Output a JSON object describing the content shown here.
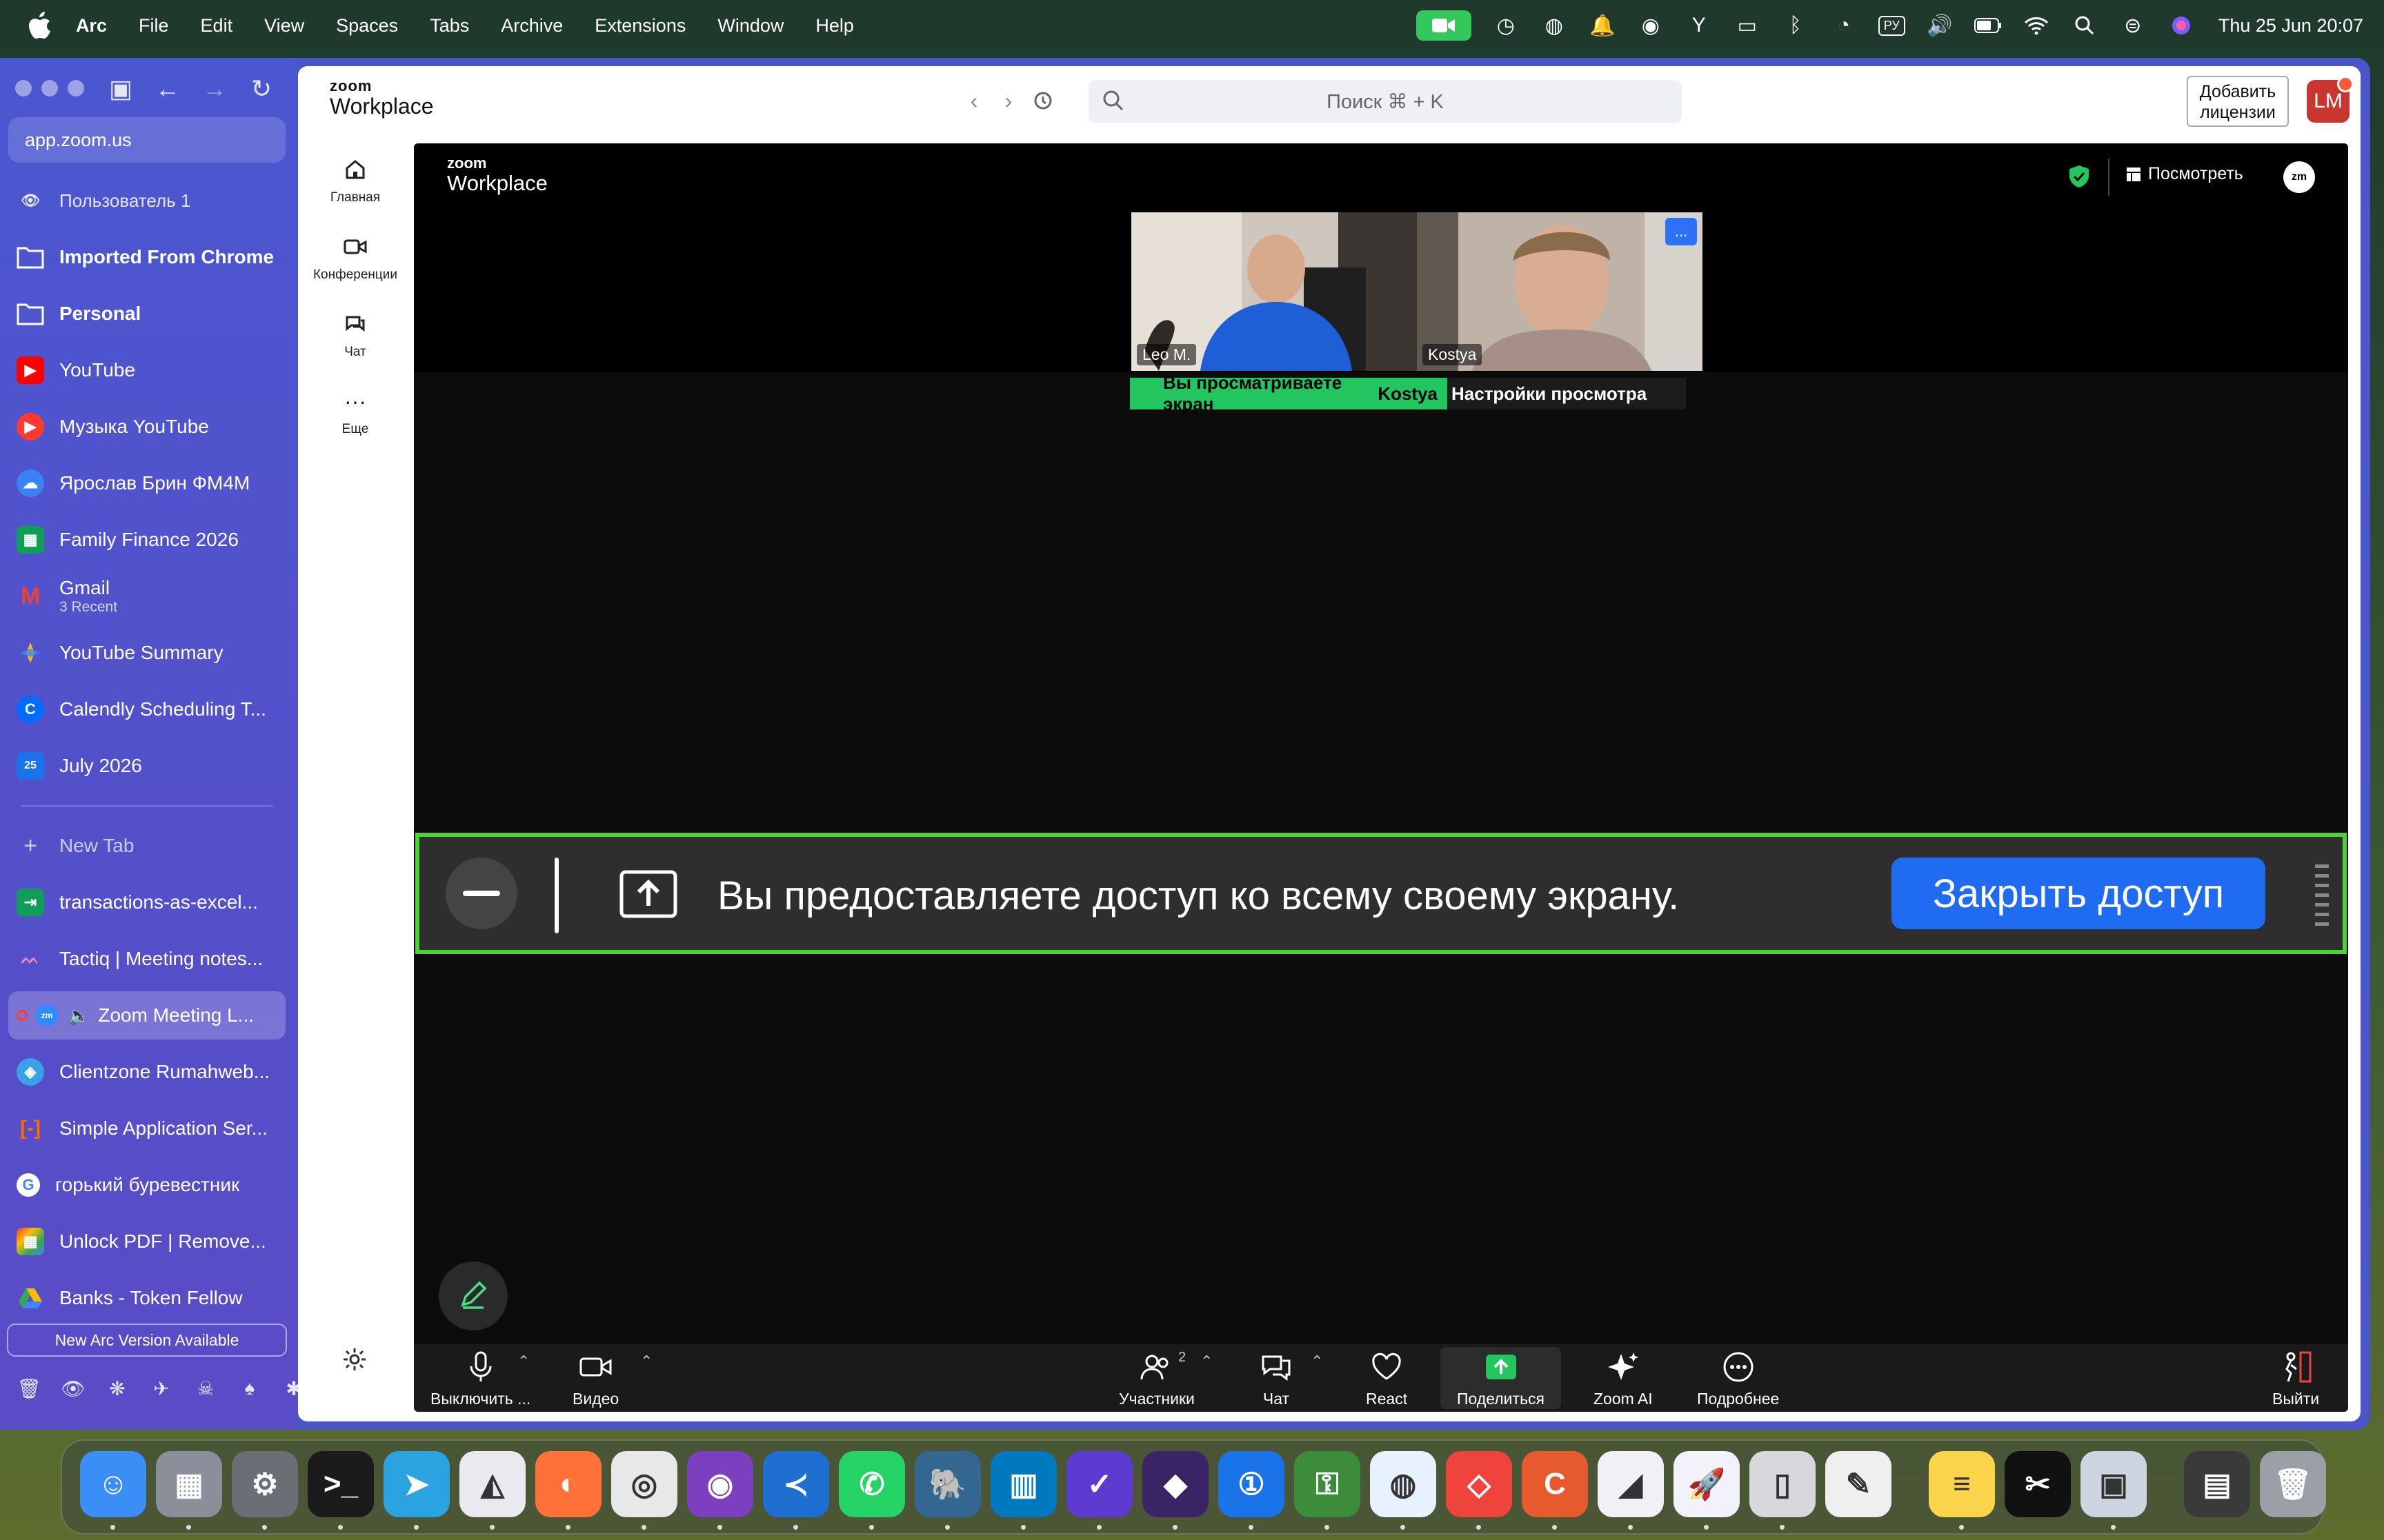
{
  "menubar": {
    "app": "Arc",
    "items": [
      "File",
      "Edit",
      "View",
      "Spaces",
      "Tabs",
      "Archive",
      "Extensions",
      "Window",
      "Help"
    ],
    "keyboard_layout": "РУ",
    "clock": "Thu 25 Jun  20:07"
  },
  "sidebar": {
    "url": "app.zoom.us",
    "items": [
      {
        "label": "Пользователь 1",
        "sub": "",
        "icon": "eye-icon",
        "color": "#5563d6"
      },
      {
        "label": "Imported From Chrome",
        "sub": "",
        "icon": "folder-icon",
        "color": "#5563d6"
      },
      {
        "label": "Personal",
        "sub": "",
        "icon": "folder-icon",
        "color": "#5563d6"
      },
      {
        "label": "YouTube",
        "sub": "",
        "icon": "youtube-icon",
        "color": "#ff0000"
      },
      {
        "label": "Музыка YouTube",
        "sub": "",
        "icon": "youtube-music-icon",
        "color": "#ff3b30"
      },
      {
        "label": "Ярослав Брин ФМ4М",
        "sub": "",
        "icon": "cloud-icon",
        "color": "#3b82f6"
      },
      {
        "label": "Family Finance 2026",
        "sub": "",
        "icon": "sheets-icon",
        "color": "#0f9d58"
      },
      {
        "label": "Gmail",
        "sub": "3 Recent",
        "icon": "gmail-icon",
        "color": "#ea4335"
      },
      {
        "label": "YouTube Summary",
        "sub": "",
        "icon": "gemini-icon",
        "color": "#fbbc05"
      },
      {
        "label": "Calendly Scheduling T...",
        "sub": "",
        "icon": "calendly-icon",
        "color": "#006bff"
      },
      {
        "label": "July 2026",
        "sub": "",
        "icon": "calendar-icon",
        "color": "#1a73e8"
      }
    ],
    "new_tab": "New Tab",
    "tabs": [
      {
        "label": "transactions-as-excel...",
        "icon": "sheets-icon",
        "color": "#0f9d58"
      },
      {
        "label": "Tactiq | Meeting notes...",
        "icon": "tactiq-icon",
        "color": "#e56aa6"
      },
      {
        "label": "Zoom Meeting L...",
        "icon": "zoom-icon",
        "color": "#2d8cff"
      },
      {
        "label": "Clientzone Rumahweb...",
        "icon": "rumahweb-icon",
        "color": "#3aa0e8"
      },
      {
        "label": "Simple Application Ser...",
        "icon": "aws-icon",
        "color": "#ff6a00"
      },
      {
        "label": "горький буревестник",
        "icon": "google-icon",
        "color": "#ffffff"
      },
      {
        "label": "Unlock PDF | Remove...",
        "icon": "pdf-icon",
        "color": "#f4b400"
      },
      {
        "label": "Banks - Token Fellow",
        "icon": "drive-icon",
        "color": "#34a853"
      }
    ],
    "update_label": "New Arc Version Available"
  },
  "zoom": {
    "logo_small": "zoom",
    "logo_big": "Workplace",
    "search_placeholder": "Поиск ⌘ + K",
    "license_button": "Добавить лицензии",
    "avatar_initials": "LM",
    "nav": [
      {
        "label": "Главная",
        "icon": "home-icon"
      },
      {
        "label": "Конференции",
        "icon": "video-icon"
      },
      {
        "label": "Чат",
        "icon": "chat-icon"
      },
      {
        "label": "Еще",
        "icon": "more-icon"
      }
    ]
  },
  "meeting": {
    "view_button": "Посмотреть",
    "zm_badge": "zm",
    "participants": [
      {
        "name": "Leo M."
      },
      {
        "name": "Kostya"
      }
    ],
    "tile_more": "...",
    "viewing_text": "Вы просматриваете экран",
    "viewing_name": "Kostya",
    "viewing_settings": "Настройки просмотра",
    "share_text": "Вы предоставляете доступ ко всему своему экрану.",
    "stop_share": "Закрыть доступ",
    "toolbar": {
      "mute": "Выключить ...",
      "video": "Видео",
      "participants": "Участники",
      "participants_count": "2",
      "chat": "Чат",
      "react": "React",
      "share": "Поделиться",
      "ai": "Zoom AI",
      "more": "Подробнее",
      "leave": "Выйти"
    }
  },
  "dock": {
    "apps": [
      {
        "name": "finder-icon",
        "color": "#3a8ef6"
      },
      {
        "name": "launchpad-icon",
        "color": "#8a8f99"
      },
      {
        "name": "system-settings-icon",
        "color": "#6b6f75"
      },
      {
        "name": "terminal-icon",
        "color": "#1b1b1b"
      },
      {
        "name": "telegram-icon",
        "color": "#2aa3e0"
      },
      {
        "name": "affinity-icon",
        "color": "#e9e9ef"
      },
      {
        "name": "firefox-icon",
        "color": "#ff7139"
      },
      {
        "name": "chrome-icon",
        "color": "#e8e8e8"
      },
      {
        "name": "github-desktop-icon",
        "color": "#7b3fbf"
      },
      {
        "name": "vscode-icon",
        "color": "#1f6fd1"
      },
      {
        "name": "whatsapp-icon",
        "color": "#25d366"
      },
      {
        "name": "postgres-icon",
        "color": "#336791"
      },
      {
        "name": "trello-icon",
        "color": "#0079bf"
      },
      {
        "name": "tasks-icon",
        "color": "#5e3bd0"
      },
      {
        "name": "obsidian-icon",
        "color": "#3b2466"
      },
      {
        "name": "1password-icon",
        "color": "#1a73e8"
      },
      {
        "name": "keepass-icon",
        "color": "#3c8c3c"
      },
      {
        "name": "proxyman-icon",
        "color": "#e8f2ff"
      },
      {
        "name": "anydesk-icon",
        "color": "#ef443b"
      },
      {
        "name": "claude-icon",
        "color": "#e55b2e"
      },
      {
        "name": "arc-icon",
        "color": "#f0f0f5"
      },
      {
        "name": "rocket-icon",
        "color": "#f3f1fa"
      },
      {
        "name": "iphone-mirroring-icon",
        "color": "#d8d8dc"
      },
      {
        "name": "textedit-icon",
        "color": "#efefef"
      },
      {
        "name": "notes-icon",
        "color": "#fbd44b"
      },
      {
        "name": "capcut-icon",
        "color": "#111111"
      },
      {
        "name": "screenshot-icon",
        "color": "#ced5e0"
      },
      {
        "name": "folder-stack-icon",
        "color": "#3a3a3a"
      },
      {
        "name": "trash-icon",
        "color": "#9aa0a6"
      }
    ]
  }
}
